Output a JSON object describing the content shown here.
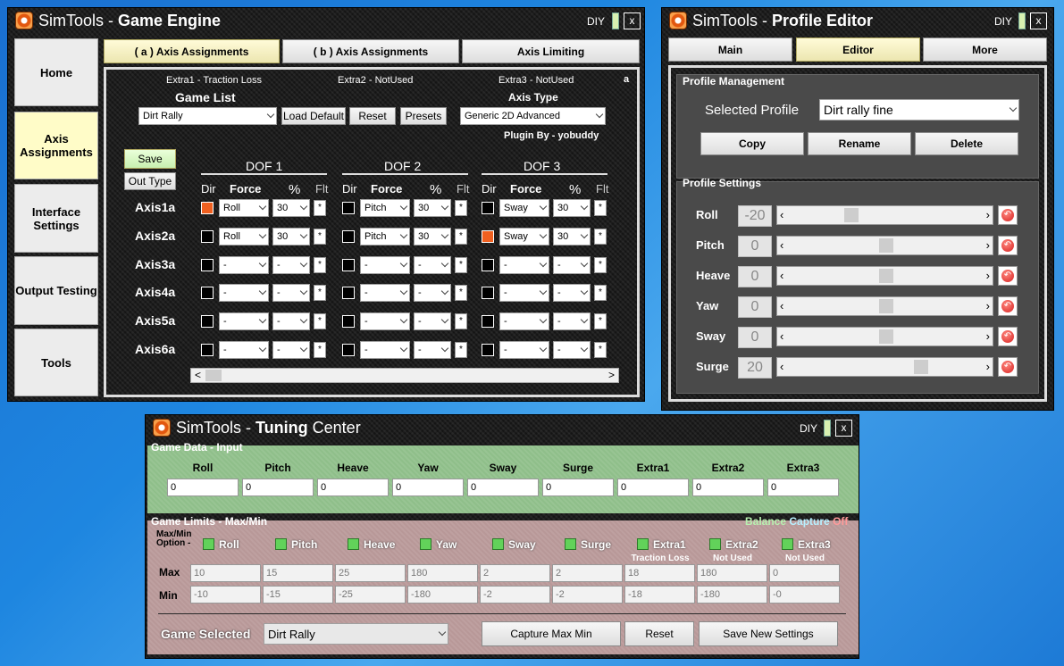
{
  "engine": {
    "title_light": "SimTools - ",
    "title_bold": "Game Engine",
    "diy": "DIY",
    "close": "x",
    "nav": [
      {
        "label": "Home"
      },
      {
        "label": "Axis Assignments"
      },
      {
        "label": "Interface Settings"
      },
      {
        "label": "Output Testing"
      },
      {
        "label": "Tools"
      }
    ],
    "tabs": [
      {
        "label": "( a ) Axis Assignments"
      },
      {
        "label": "( b ) Axis Assignments"
      },
      {
        "label": "Axis Limiting"
      }
    ],
    "extra1": "Extra1 - Traction Loss",
    "extra2": "Extra2 - NotUsed",
    "extra3": "Extra3 - NotUsed",
    "corner_letter": "a",
    "game_list_label": "Game List",
    "game_selected": "Dirt Rally",
    "load_default": "Load Default",
    "reset": "Reset",
    "presets": "Presets",
    "axis_type_label": "Axis Type",
    "axis_type": "Generic 2D Advanced",
    "plugin_by": "Plugin By - yobuddy",
    "save": "Save",
    "out_type": "Out Type",
    "dof": [
      "DOF 1",
      "DOF 2",
      "DOF 3"
    ],
    "col_headers": {
      "dir": "Dir",
      "force": "Force",
      "pct": "%",
      "flt": "Flt"
    },
    "axes": [
      {
        "label": "Axis1a",
        "cells": [
          {
            "dir_on": true,
            "force": "Roll",
            "pct": "30",
            "flt": "*"
          },
          {
            "dir_on": false,
            "force": "Pitch",
            "pct": "30",
            "flt": "*"
          },
          {
            "dir_on": false,
            "force": "Sway",
            "pct": "30",
            "flt": "*"
          }
        ]
      },
      {
        "label": "Axis2a",
        "cells": [
          {
            "dir_on": false,
            "force": "Roll",
            "pct": "30",
            "flt": "*"
          },
          {
            "dir_on": false,
            "force": "Pitch",
            "pct": "30",
            "flt": "*"
          },
          {
            "dir_on": true,
            "force": "Sway",
            "pct": "30",
            "flt": "*"
          }
        ]
      },
      {
        "label": "Axis3a",
        "cells": [
          {
            "dir_on": false,
            "force": "-",
            "pct": "-",
            "flt": "*"
          },
          {
            "dir_on": false,
            "force": "-",
            "pct": "-",
            "flt": "*"
          },
          {
            "dir_on": false,
            "force": "-",
            "pct": "-",
            "flt": "*"
          }
        ]
      },
      {
        "label": "Axis4a",
        "cells": [
          {
            "dir_on": false,
            "force": "-",
            "pct": "-",
            "flt": "*"
          },
          {
            "dir_on": false,
            "force": "-",
            "pct": "-",
            "flt": "*"
          },
          {
            "dir_on": false,
            "force": "-",
            "pct": "-",
            "flt": "*"
          }
        ]
      },
      {
        "label": "Axis5a",
        "cells": [
          {
            "dir_on": false,
            "force": "-",
            "pct": "-",
            "flt": "*"
          },
          {
            "dir_on": false,
            "force": "-",
            "pct": "-",
            "flt": "*"
          },
          {
            "dir_on": false,
            "force": "-",
            "pct": "-",
            "flt": "*"
          }
        ]
      },
      {
        "label": "Axis6a",
        "cells": [
          {
            "dir_on": false,
            "force": "-",
            "pct": "-",
            "flt": "*"
          },
          {
            "dir_on": false,
            "force": "-",
            "pct": "-",
            "flt": "*"
          },
          {
            "dir_on": false,
            "force": "-",
            "pct": "-",
            "flt": "*"
          }
        ]
      }
    ],
    "scroll_left": "<",
    "scroll_right": ">"
  },
  "profile": {
    "title_light": "SimTools - ",
    "title_bold": "Profile Editor",
    "diy": "DIY",
    "close": "x",
    "tabs": [
      {
        "label": "Main"
      },
      {
        "label": "Editor"
      },
      {
        "label": "More"
      }
    ],
    "mgmt_label": "Profile Management",
    "selected_profile_label": "Selected Profile",
    "selected_profile": "Dirt rally fine",
    "copy": "Copy",
    "rename": "Rename",
    "delete": "Delete",
    "settings_label": "Profile Settings",
    "sliders": [
      {
        "name": "Roll",
        "value": "-20",
        "level": -20
      },
      {
        "name": "Pitch",
        "value": "0",
        "level": 0
      },
      {
        "name": "Heave",
        "value": "0",
        "level": 0
      },
      {
        "name": "Yaw",
        "value": "0",
        "level": 0
      },
      {
        "name": "Sway",
        "value": "0",
        "level": 0
      },
      {
        "name": "Surge",
        "value": "20",
        "level": 20
      }
    ]
  },
  "tuning": {
    "title_light": "SimTools - ",
    "title_bold": "Tuning",
    "title_rest": " Center",
    "diy": "DIY",
    "close": "x",
    "game_data_label": "Game Data - Input",
    "inputs": [
      {
        "name": "Roll",
        "value": "0"
      },
      {
        "name": "Pitch",
        "value": "0"
      },
      {
        "name": "Heave",
        "value": "0"
      },
      {
        "name": "Yaw",
        "value": "0"
      },
      {
        "name": "Sway",
        "value": "0"
      },
      {
        "name": "Surge",
        "value": "0"
      },
      {
        "name": "Extra1",
        "value": "0"
      },
      {
        "name": "Extra2",
        "value": "0"
      },
      {
        "name": "Extra3",
        "value": "0"
      }
    ],
    "limits_label": "Game Limits - Max/Min",
    "balance": "Balance",
    "capture": "Capture",
    "off": "Off",
    "option_label_1": "Max/Min",
    "option_label_2": "Option -",
    "max_label": "Max",
    "min_label": "Min",
    "limits": [
      {
        "name": "Roll",
        "sub": "",
        "max": "10",
        "min": "-10"
      },
      {
        "name": "Pitch",
        "sub": "",
        "max": "15",
        "min": "-15"
      },
      {
        "name": "Heave",
        "sub": "",
        "max": "25",
        "min": "-25"
      },
      {
        "name": "Yaw",
        "sub": "",
        "max": "180",
        "min": "-180"
      },
      {
        "name": "Sway",
        "sub": "",
        "max": "2",
        "min": "-2"
      },
      {
        "name": "Surge",
        "sub": "",
        "max": "2",
        "min": "-2"
      },
      {
        "name": "Extra1",
        "sub": "Traction Loss",
        "max": "18",
        "min": "-18"
      },
      {
        "name": "Extra2",
        "sub": "Not Used",
        "max": "180",
        "min": "-180"
      },
      {
        "name": "Extra3",
        "sub": "Not Used",
        "max": "0",
        "min": "-0"
      }
    ],
    "game_selected_label": "Game Selected",
    "game_selected": "Dirt Rally",
    "capture_btn": "Capture Max Min",
    "reset_btn": "Reset",
    "save_btn": "Save New Settings"
  }
}
